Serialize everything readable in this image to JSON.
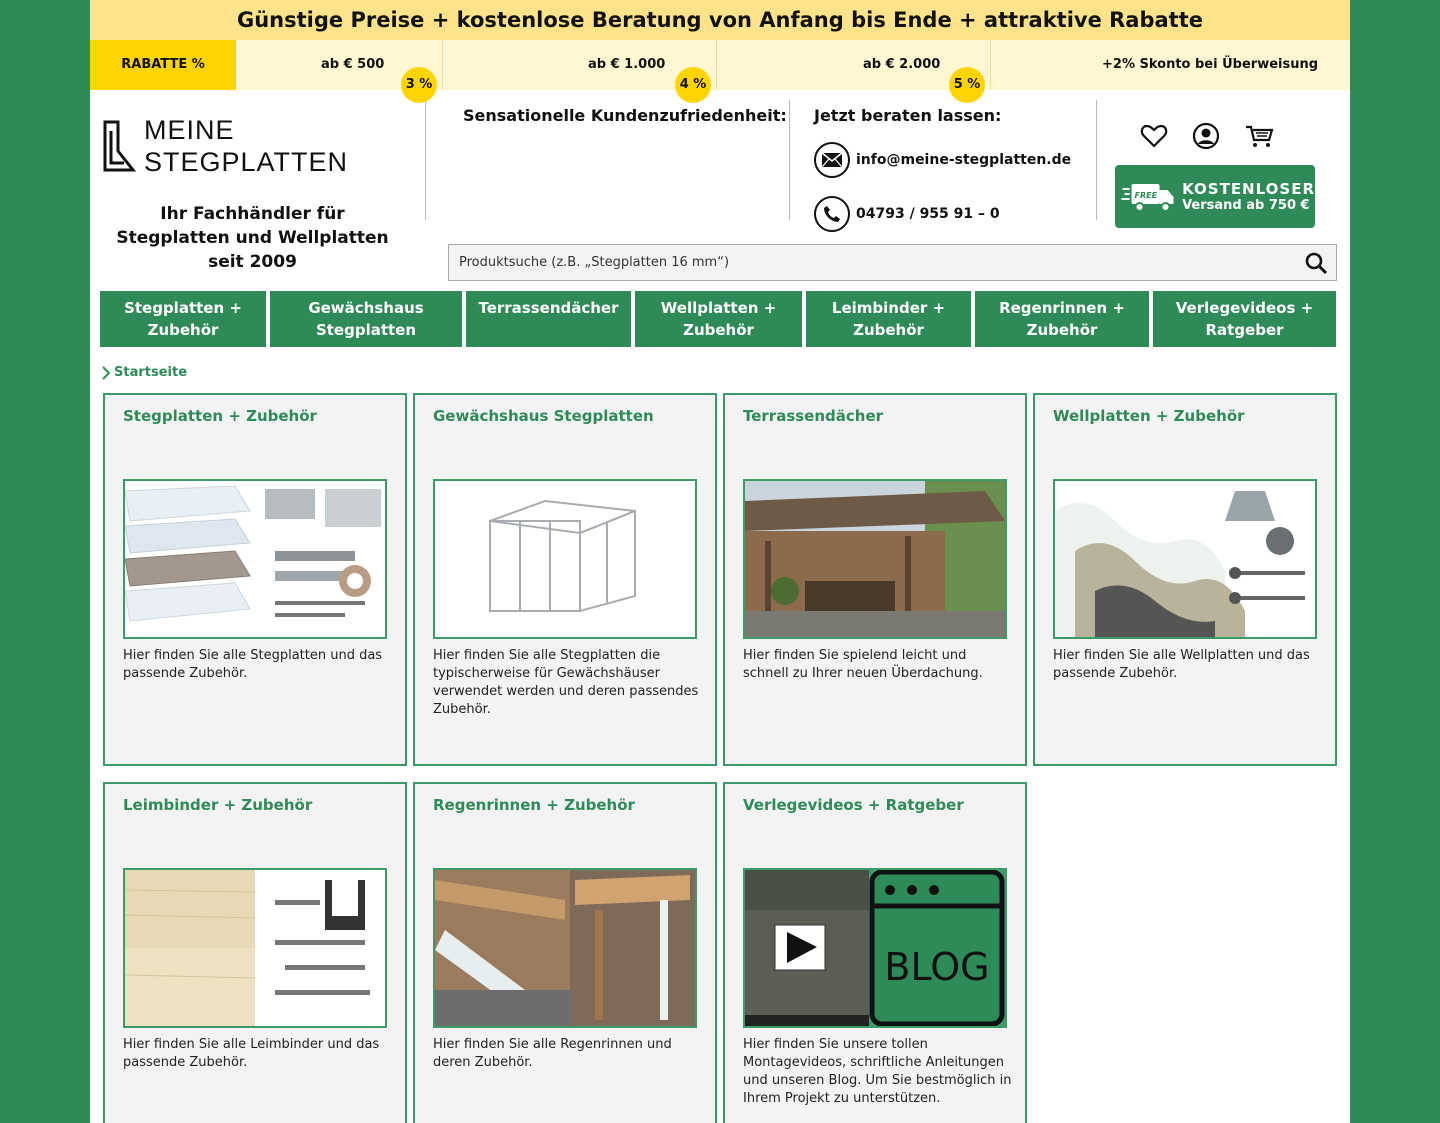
{
  "promo": "Günstige Preise + kostenlose Beratung von Anfang bis Ende + attraktive Rabatte",
  "discounts": {
    "label": "RABATTE %",
    "tiers": [
      {
        "amount": "ab € 500",
        "percent": "3 %"
      },
      {
        "amount": "ab € 1.000",
        "percent": "4 %"
      },
      {
        "amount": "ab € 2.000",
        "percent": "5 %"
      }
    ],
    "skonto": "+2% Skonto bei Überweisung"
  },
  "header": {
    "logo_line1": "MEINE",
    "logo_line2": "STEGPLATTEN",
    "tagline": "Ihr Fachhändler für Stegplatten und Wellplatten seit 2009",
    "satisfaction": "Sensationelle Kundenzufriedenheit:",
    "consult": "Jetzt beraten lassen:",
    "email": "info@meine-stegplatten.de",
    "phone": "04793 / 955 91 – 0",
    "shipping_title": "KOSTENLOSER",
    "shipping_sub": "Versand ab 750 €",
    "truck_label": "FREE",
    "search_placeholder": "Produktsuche (z.B. „Stegplatten 16 mm“)"
  },
  "nav": [
    "Stegplatten + Zubehör",
    "Gewächshaus Stegplatten",
    "Terrassendächer",
    "Wellplatten + Zubehör",
    "Leimbinder + Zubehör",
    "Regenrinnen + Zubehör",
    "Verlegevideos + Ratgeber"
  ],
  "breadcrumb": "Startseite",
  "categories": [
    {
      "title": "Stegplatten + Zubehör",
      "text": "Hier finden Sie alle Stegplatten und das passende Zubehör."
    },
    {
      "title": "Gewächshaus Stegplatten",
      "text": "Hier finden Sie alle Stegplatten die typischerweise für Gewächshäuser verwendet werden und deren passendes Zubehör."
    },
    {
      "title": "Terrassendächer",
      "text": "Hier finden Sie spielend leicht und schnell zu Ihrer neuen Überdachung."
    },
    {
      "title": "Wellplatten + Zubehör",
      "text": "Hier finden Sie alle Wellplatten und das passende Zubehör."
    },
    {
      "title": "Leimbinder + Zubehör",
      "text": "Hier finden Sie alle Leimbinder und das passende Zubehör."
    },
    {
      "title": "Regenrinnen + Zubehör",
      "text": "Hier finden Sie alle Regenrinnen und deren Zubehör."
    },
    {
      "title": "Verlegevideos + Ratgeber",
      "text": "Hier finden Sie unsere tollen Montagevideos, schriftliche Anleitungen und unseren Blog. Um Sie bestmöglich in Ihrem Projekt zu unterstützen."
    }
  ],
  "blog_label": "BLOG",
  "colors": {
    "brand_green": "#2e8b57",
    "yellow": "#ffd400",
    "promo_bg": "#ffe38a"
  }
}
